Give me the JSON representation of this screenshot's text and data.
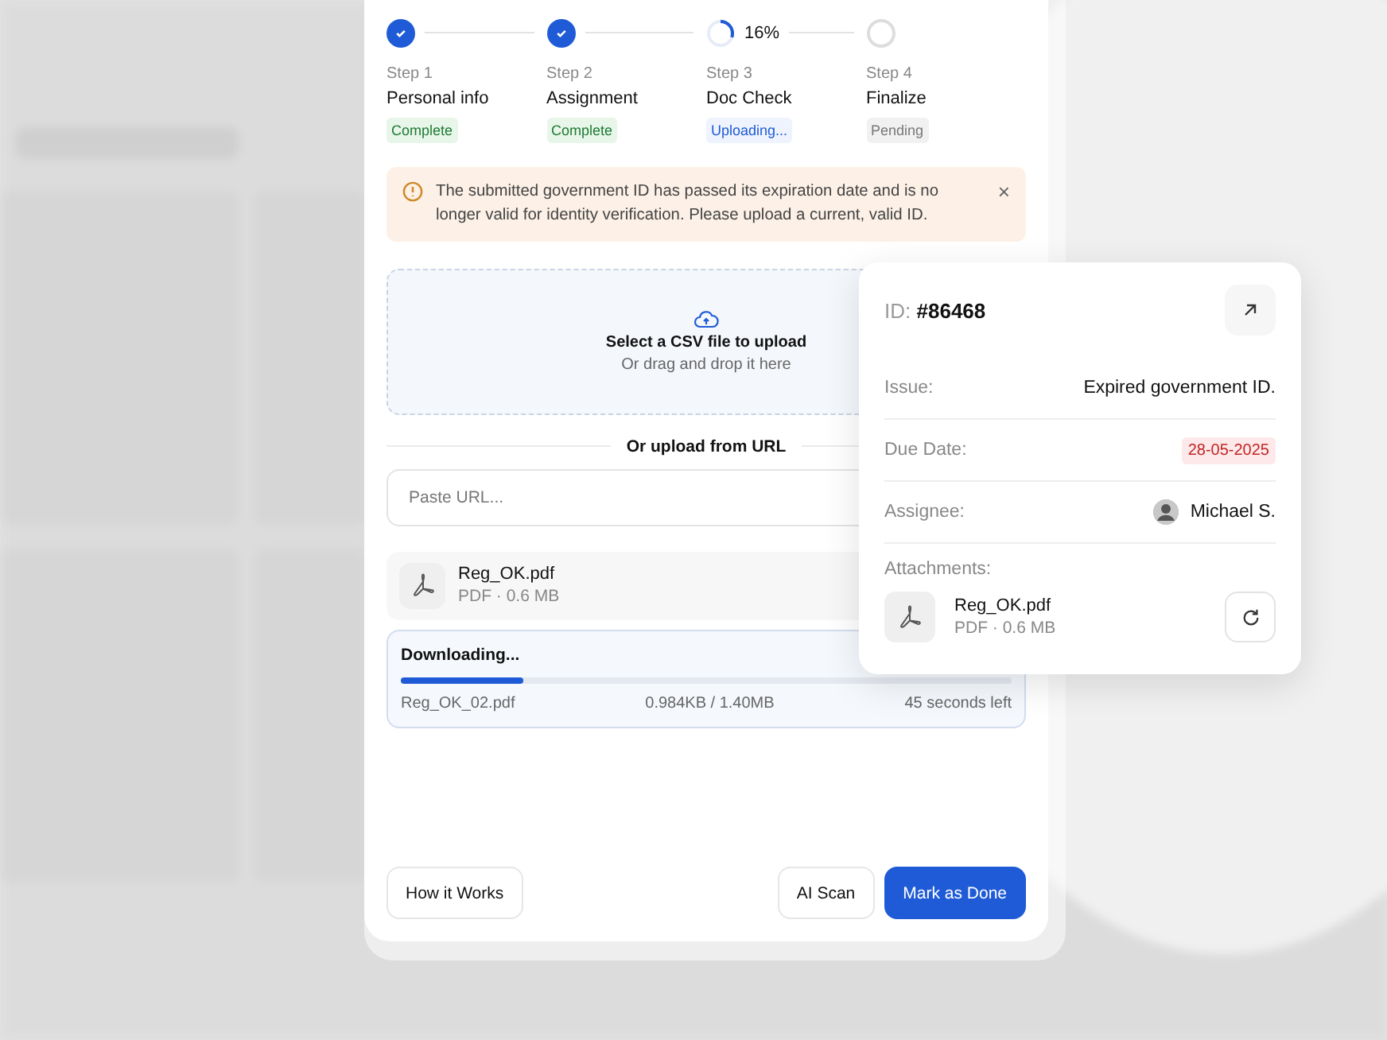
{
  "steps": [
    {
      "label": "Step 1",
      "name": "Personal info",
      "kind": "complete",
      "badge": "Complete"
    },
    {
      "label": "Step 2",
      "name": "Assignment",
      "kind": "complete",
      "badge": "Complete"
    },
    {
      "label": "Step 3",
      "name": "Doc Check",
      "kind": "uploading",
      "badge": "Uploading...",
      "percent": "16%"
    },
    {
      "label": "Step 4",
      "name": "Finalize",
      "kind": "pending",
      "badge": "Pending"
    }
  ],
  "alert": {
    "message": "The submitted government ID has passed its expiration date and is no longer valid for identity verification. Please upload a current, valid ID.",
    "close": "×"
  },
  "dropzone": {
    "title": "Select a CSV file to upload",
    "subtitle": "Or drag and drop it here"
  },
  "url_divider": "Or upload from URL",
  "url_field": {
    "placeholder": "Paste URL..."
  },
  "file": {
    "name": "Reg_OK.pdf",
    "meta": "PDF · 0.6 MB"
  },
  "download": {
    "title": "Downloading...",
    "level": 0.2,
    "file": "Reg_OK_02.pdf",
    "size": "0.984KB / 1.40MB",
    "remaining": "45 seconds left"
  },
  "footer": {
    "help": "How it Works",
    "secondary": "AI Scan",
    "primary": "Mark as Done"
  },
  "details": {
    "id_label": "ID:",
    "id": "#86468",
    "rows": [
      {
        "label": "Issue:",
        "value": "Expired government ID.",
        "kind": "text"
      },
      {
        "label": "Due Date:",
        "value": "28-05-2025",
        "kind": "date"
      },
      {
        "label": "Assignee:",
        "value": "Michael S.",
        "kind": "person"
      }
    ],
    "attachments_label": "Attachments:",
    "attachment": {
      "name": "Reg_OK.pdf",
      "meta": "PDF · 0.6 MB"
    }
  }
}
